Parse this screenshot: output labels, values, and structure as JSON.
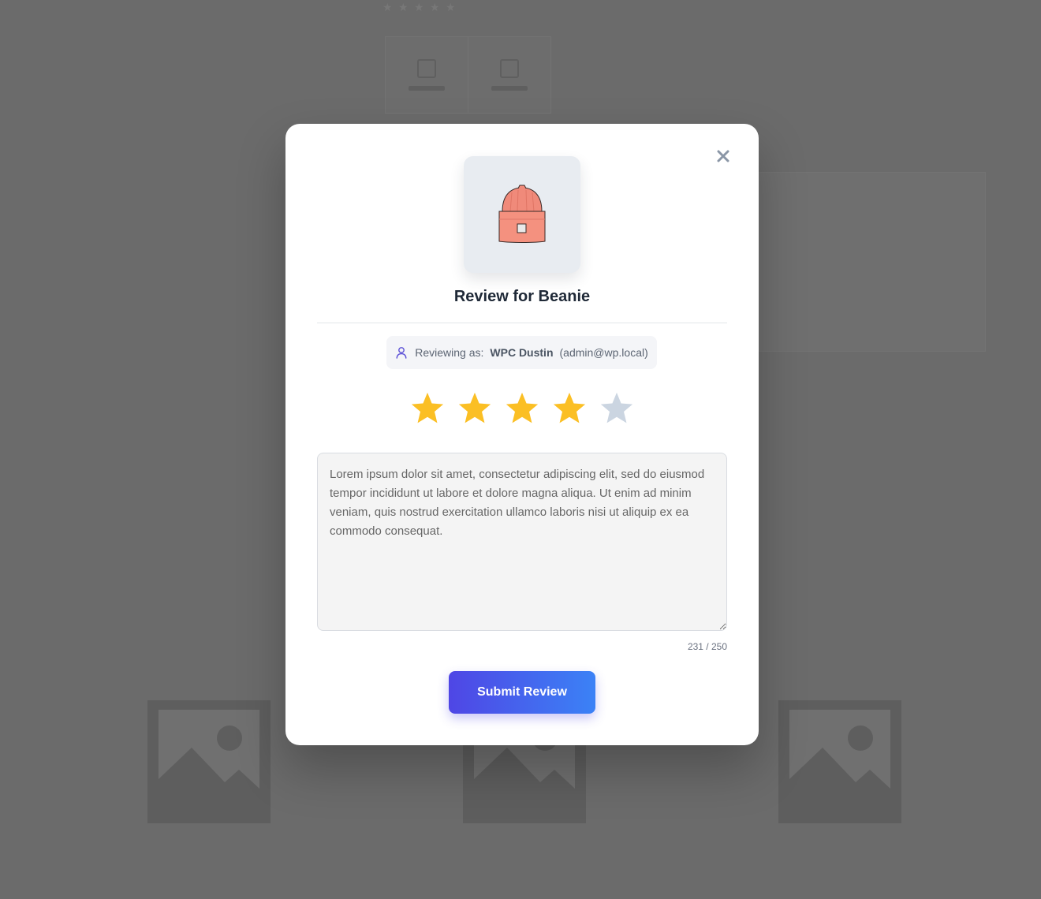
{
  "modal": {
    "title": "Review for Beanie",
    "close_icon": "close-icon",
    "product_image_icon": "beanie-hat-icon",
    "reviewer": {
      "prefix": "Reviewing as:",
      "name": "WPC Dustin",
      "email": "(admin@wp.local)",
      "icon": "user-icon"
    },
    "rating": {
      "value": 4,
      "max": 5,
      "filled_color": "#fbbf24",
      "empty_color": "#cbd5e1"
    },
    "review_text": "Lorem ipsum dolor sit amet, consectetur adipiscing elit, sed do eiusmod tempor incididunt ut labore et dolore magna aliqua. Ut enim ad minim veniam, quis nostrud exercitation ullamco laboris nisi ut aliquip ex ea commodo consequat.",
    "char_counter": "231 / 250",
    "submit_label": "Submit Review",
    "accent_gradient": [
      "#4f46e5",
      "#3b82f6"
    ]
  },
  "background": {
    "overlay_color": "#6b6b6b",
    "placeholder_icon": "image-placeholder-icon"
  }
}
